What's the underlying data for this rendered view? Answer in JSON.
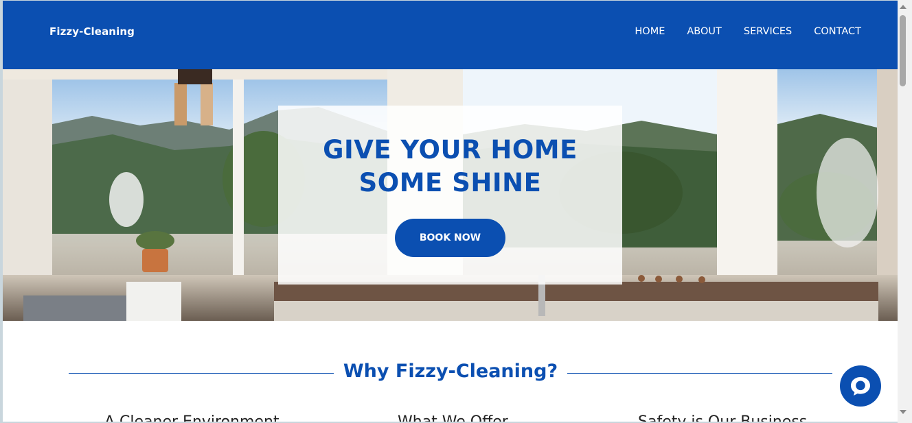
{
  "navbar": {
    "brand": "Fizzy-Cleaning",
    "links": [
      "HOME",
      "ABOUT",
      "SERVICES",
      "CONTACT"
    ]
  },
  "hero": {
    "title_line1": "GIVE YOUR HOME",
    "title_line2": "SOME SHINE",
    "cta_label": "BOOK NOW"
  },
  "why": {
    "title": "Why Fizzy-Cleaning?",
    "features": [
      "A Cleaner Environment",
      "What We Offer",
      "Safety is Our Business"
    ]
  },
  "chat": {
    "icon": "chat-bubble-icon"
  },
  "colors": {
    "brand_blue": "#0b4fb1",
    "white": "#ffffff"
  }
}
